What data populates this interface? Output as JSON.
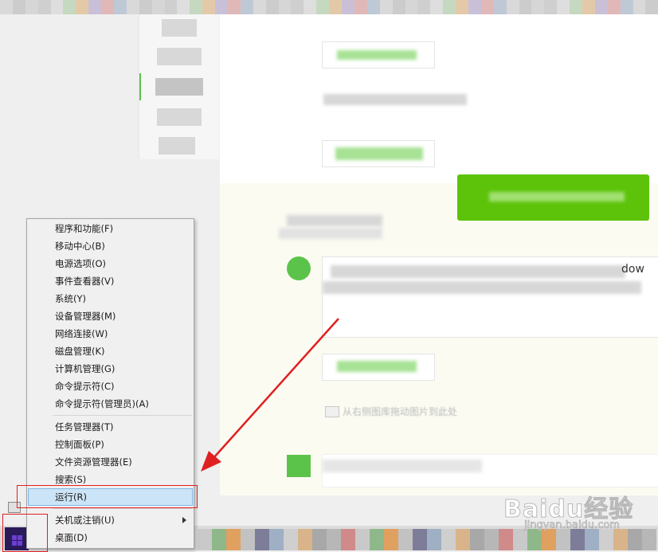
{
  "context_menu": {
    "items_group1": [
      {
        "label": "程序和功能(F)"
      },
      {
        "label": "移动中心(B)"
      },
      {
        "label": "电源选项(O)"
      },
      {
        "label": "事件查看器(V)"
      },
      {
        "label": "系统(Y)"
      },
      {
        "label": "设备管理器(M)"
      },
      {
        "label": "网络连接(W)"
      },
      {
        "label": "磁盘管理(K)"
      },
      {
        "label": "计算机管理(G)"
      },
      {
        "label": "命令提示符(C)"
      },
      {
        "label": "命令提示符(管理员)(A)"
      }
    ],
    "items_group2": [
      {
        "label": "任务管理器(T)"
      },
      {
        "label": "控制面板(P)"
      },
      {
        "label": "文件资源管理器(E)"
      },
      {
        "label": "搜索(S)"
      },
      {
        "label": "运行(R)",
        "selected": true
      }
    ],
    "items_group3": [
      {
        "label": "关机或注销(U)",
        "has_submenu": true
      },
      {
        "label": "桌面(D)"
      }
    ]
  },
  "background": {
    "partial_text": "dow",
    "hint_text": "从右侧图库拖动图片到此处"
  },
  "watermark": {
    "logo": "Baidu经验",
    "url": "jingyan.baidu.com"
  },
  "colors": {
    "accent_green": "#5cc30a",
    "highlight_red": "#e02020",
    "menu_selected": "#cce4f7"
  }
}
